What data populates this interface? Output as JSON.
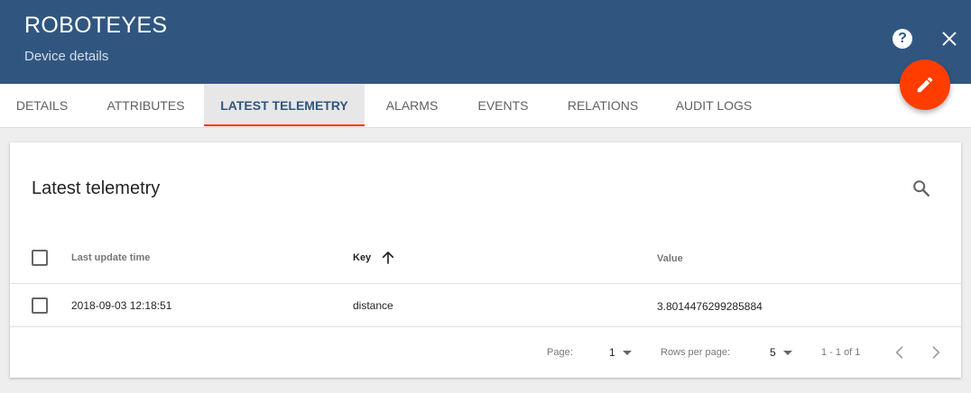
{
  "header": {
    "title": "ROBOTEYES",
    "subtitle": "Device details",
    "help_glyph": "?",
    "icons": [
      "help-circle-icon",
      "close-icon",
      "pencil-icon"
    ]
  },
  "tabs": [
    {
      "label": "DETAILS",
      "active": false
    },
    {
      "label": "ATTRIBUTES",
      "active": false
    },
    {
      "label": "LATEST TELEMETRY",
      "active": true
    },
    {
      "label": "ALARMS",
      "active": false
    },
    {
      "label": "EVENTS",
      "active": false
    },
    {
      "label": "RELATIONS",
      "active": false
    },
    {
      "label": "AUDIT LOGS",
      "active": false
    }
  ],
  "card": {
    "title": "Latest telemetry",
    "columns": {
      "last_update": "Last update time",
      "key": "Key",
      "value": "Value"
    },
    "sort": {
      "column": "Key",
      "direction": "ascending"
    },
    "rows": [
      {
        "last_update": "2018-09-03 12:18:51",
        "key": "distance",
        "value": "3.8014476299285884"
      }
    ]
  },
  "pagination": {
    "page_label": "Page:",
    "page_value": "1",
    "rows_label": "Rows per page:",
    "rows_value": "5",
    "range": "1 - 1 of 1"
  },
  "colors": {
    "header_bg": "#305680",
    "accent": "#ff3d00",
    "active_tab_bg": "#e7e7e7"
  }
}
